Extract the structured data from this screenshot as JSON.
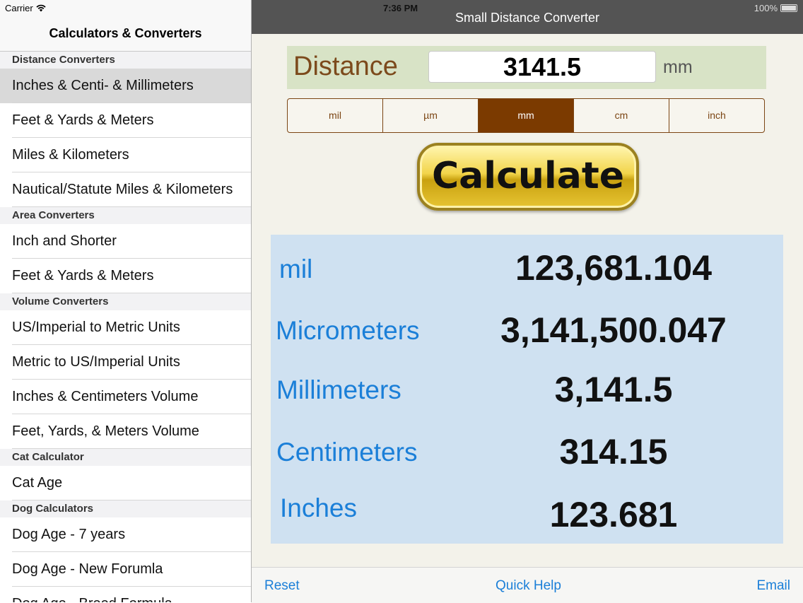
{
  "status": {
    "carrier": "Carrier",
    "time": "7:36 PM",
    "battery": "100%"
  },
  "sidebar": {
    "title": "Calculators & Converters",
    "sections": [
      {
        "header": "Distance Converters",
        "items": [
          "Inches & Centi- & Millimeters",
          "Feet & Yards & Meters",
          "Miles & Kilometers",
          "Nautical/Statute Miles & Kilometers"
        ]
      },
      {
        "header": "Area Converters",
        "items": [
          "Inch and Shorter",
          "Feet & Yards & Meters"
        ]
      },
      {
        "header": "Volume Converters",
        "items": [
          "US/Imperial to Metric Units",
          "Metric to US/Imperial Units",
          "Inches & Centimeters Volume",
          "Feet, Yards, & Meters Volume"
        ]
      },
      {
        "header": "Cat Calculator",
        "items": [
          "Cat Age"
        ]
      },
      {
        "header": "Dog Calculators",
        "items": [
          "Dog Age - 7 years",
          "Dog Age - New Forumla",
          "Dog Age - Breed Formula"
        ]
      }
    ]
  },
  "main": {
    "title": "Small Distance Converter",
    "distance_label": "Distance",
    "distance_value": "3141.5",
    "distance_unit": "mm",
    "units": [
      "mil",
      "µm",
      "mm",
      "cm",
      "inch"
    ],
    "selected_unit": "mm",
    "calculate_label": "Calculate",
    "results": [
      {
        "label": "mil",
        "value": "123,681.104"
      },
      {
        "label": "Micrometers",
        "value": "3,141,500.047"
      },
      {
        "label": "Millimeters",
        "value": "3,141.5"
      },
      {
        "label": "Centimeters",
        "value": "314.15"
      },
      {
        "label": "Inches",
        "value": "123.681"
      }
    ],
    "bottom": {
      "reset": "Reset",
      "help": "Quick Help",
      "email": "Email"
    }
  },
  "colors": {
    "accent": "#1b7fd8",
    "selected_segment": "#7b3a00",
    "results_bg": "#cfe1f1",
    "distance_bg": "#d8e3c6"
  }
}
